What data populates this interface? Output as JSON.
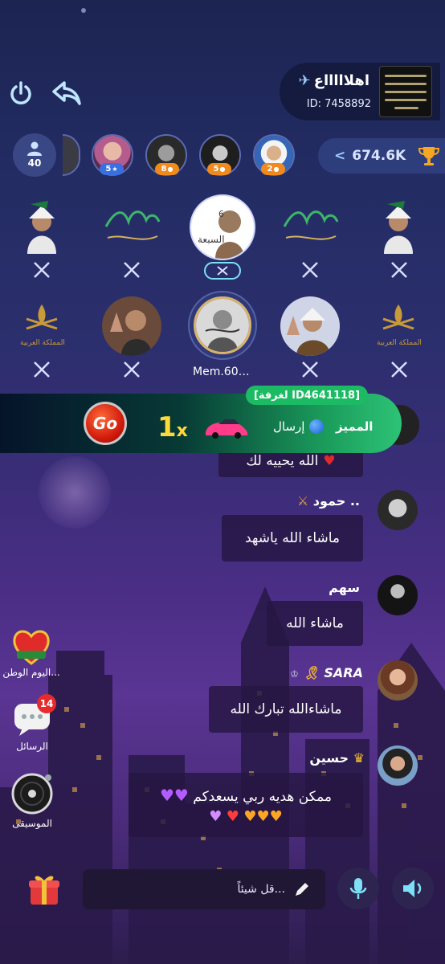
{
  "room": {
    "title": "اهلاااااع",
    "id_text": "ID: 7458892"
  },
  "members": {
    "count": "40",
    "badges": [
      "5",
      "8",
      "5",
      "2"
    ]
  },
  "score": {
    "value": "674.6K",
    "arrow": "<"
  },
  "seats": {
    "host_name": "Mem.60…"
  },
  "banner": {
    "tag": "[لغرفة ID4641118]",
    "go_label": "Go",
    "multiplier": "1",
    "multiplier_suffix": "x",
    "send_label": "إرسال",
    "sender": "المميز"
  },
  "chat": [
    {
      "user": "",
      "text": "الله يحييه لك"
    },
    {
      "user": "حمود ..",
      "text": "ماشاء الله ياشهد"
    },
    {
      "user": "سهم",
      "text": "ماشاء الله"
    },
    {
      "user": "SARA",
      "text": "ماشاءالله تبارك الله"
    },
    {
      "user": "حسين",
      "text": "ممكن هديه ربي يسعدكم"
    }
  ],
  "side": {
    "national_day": "اليوم الوطن...",
    "national_badge": "OMAN",
    "messages": "الرسائل",
    "messages_count": "14",
    "music": "الموسيقى"
  },
  "composer": {
    "placeholder": "قل شيئاً..."
  },
  "colors": {
    "accent_teal": "#7ee0f5",
    "banner_green": "#1cbb63",
    "gold": "#ffd93a"
  }
}
